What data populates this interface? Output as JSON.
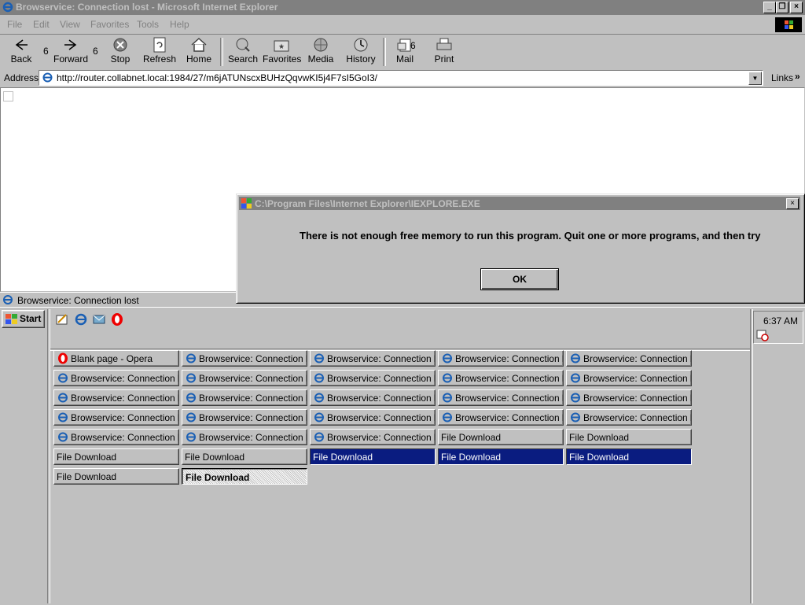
{
  "window": {
    "title": "Browservice: Connection lost - Microsoft Internet Explorer"
  },
  "menu": [
    "File",
    "Edit",
    "View",
    "Favorites",
    "Tools",
    "Help"
  ],
  "toolbar": {
    "back": "Back",
    "back_count": "6",
    "forward": "Forward",
    "forward_count": "6",
    "stop": "Stop",
    "refresh": "Refresh",
    "home": "Home",
    "search": "Search",
    "favorites": "Favorites",
    "media": "Media",
    "history": "History",
    "mail": "Mail",
    "mail_count": "6",
    "print": "Print"
  },
  "address": {
    "label": "Address",
    "url": "http://router.collabnet.local:1984/27/m6jATUNscxBUHzQqvwKI5j4F7sI5GoI3/",
    "links_label": "Links"
  },
  "status": {
    "text": "Browservice: Connection lost"
  },
  "taskbar": {
    "start_label": "Start",
    "clock": "6:37 AM",
    "buttons": [
      {
        "label": "Blank page - Opera",
        "icon": "opera-icon",
        "state": "normal"
      },
      {
        "label": "Browservice: Connection l...",
        "icon": "ie-icon",
        "state": "normal"
      },
      {
        "label": "Browservice: Connection l...",
        "icon": "ie-icon",
        "state": "normal"
      },
      {
        "label": "Browservice: Connection l...",
        "icon": "ie-icon",
        "state": "normal"
      },
      {
        "label": "Browservice: Connection l...",
        "icon": "ie-icon",
        "state": "normal"
      },
      {
        "label": "Browservice: Connection l...",
        "icon": "ie-icon",
        "state": "normal"
      },
      {
        "label": "Browservice: Connection l...",
        "icon": "ie-icon",
        "state": "normal"
      },
      {
        "label": "Browservice: Connection l...",
        "icon": "ie-icon",
        "state": "normal"
      },
      {
        "label": "Browservice: Connection l...",
        "icon": "ie-icon",
        "state": "normal"
      },
      {
        "label": "Browservice: Connection l...",
        "icon": "ie-icon",
        "state": "normal"
      },
      {
        "label": "Browservice: Connection l...",
        "icon": "ie-icon",
        "state": "normal"
      },
      {
        "label": "Browservice: Connection l...",
        "icon": "ie-icon",
        "state": "normal"
      },
      {
        "label": "Browservice: Connection l...",
        "icon": "ie-icon",
        "state": "normal"
      },
      {
        "label": "Browservice: Connection l...",
        "icon": "ie-icon",
        "state": "normal"
      },
      {
        "label": "Browservice: Connection l...",
        "icon": "ie-icon",
        "state": "normal"
      },
      {
        "label": "Browservice: Connection l...",
        "icon": "ie-icon",
        "state": "normal"
      },
      {
        "label": "Browservice: Connection l...",
        "icon": "ie-icon",
        "state": "normal"
      },
      {
        "label": "Browservice: Connection l...",
        "icon": "ie-icon",
        "state": "normal"
      },
      {
        "label": "Browservice: Connection l...",
        "icon": "ie-icon",
        "state": "normal"
      },
      {
        "label": "Browservice: Connection l...",
        "icon": "ie-icon",
        "state": "normal"
      },
      {
        "label": "Browservice: Connection l...",
        "icon": "ie-icon",
        "state": "normal"
      },
      {
        "label": "Browservice: Connection l...",
        "icon": "ie-icon",
        "state": "normal"
      },
      {
        "label": "Browservice: Connection l...",
        "icon": "ie-icon",
        "state": "normal"
      },
      {
        "label": "File Download",
        "icon": "",
        "state": "normal"
      },
      {
        "label": "File Download",
        "icon": "",
        "state": "normal"
      },
      {
        "label": "File Download",
        "icon": "",
        "state": "normal"
      },
      {
        "label": "File Download",
        "icon": "",
        "state": "normal"
      },
      {
        "label": "File Download",
        "icon": "",
        "state": "selected"
      },
      {
        "label": "File Download",
        "icon": "",
        "state": "selected"
      },
      {
        "label": "File Download",
        "icon": "",
        "state": "selected"
      },
      {
        "label": "File Download",
        "icon": "",
        "state": "normal"
      },
      {
        "label": "File Download",
        "icon": "",
        "state": "pressed"
      }
    ]
  },
  "dialog": {
    "title": "C:\\Program Files\\Internet Explorer\\IEXPLORE.EXE",
    "message": "There is not enough free memory to run this program. Quit one or more programs, and then try",
    "ok_label": "OK"
  },
  "colors": {
    "selected_task": "#0a1c80",
    "title_inactive": "#808080"
  }
}
